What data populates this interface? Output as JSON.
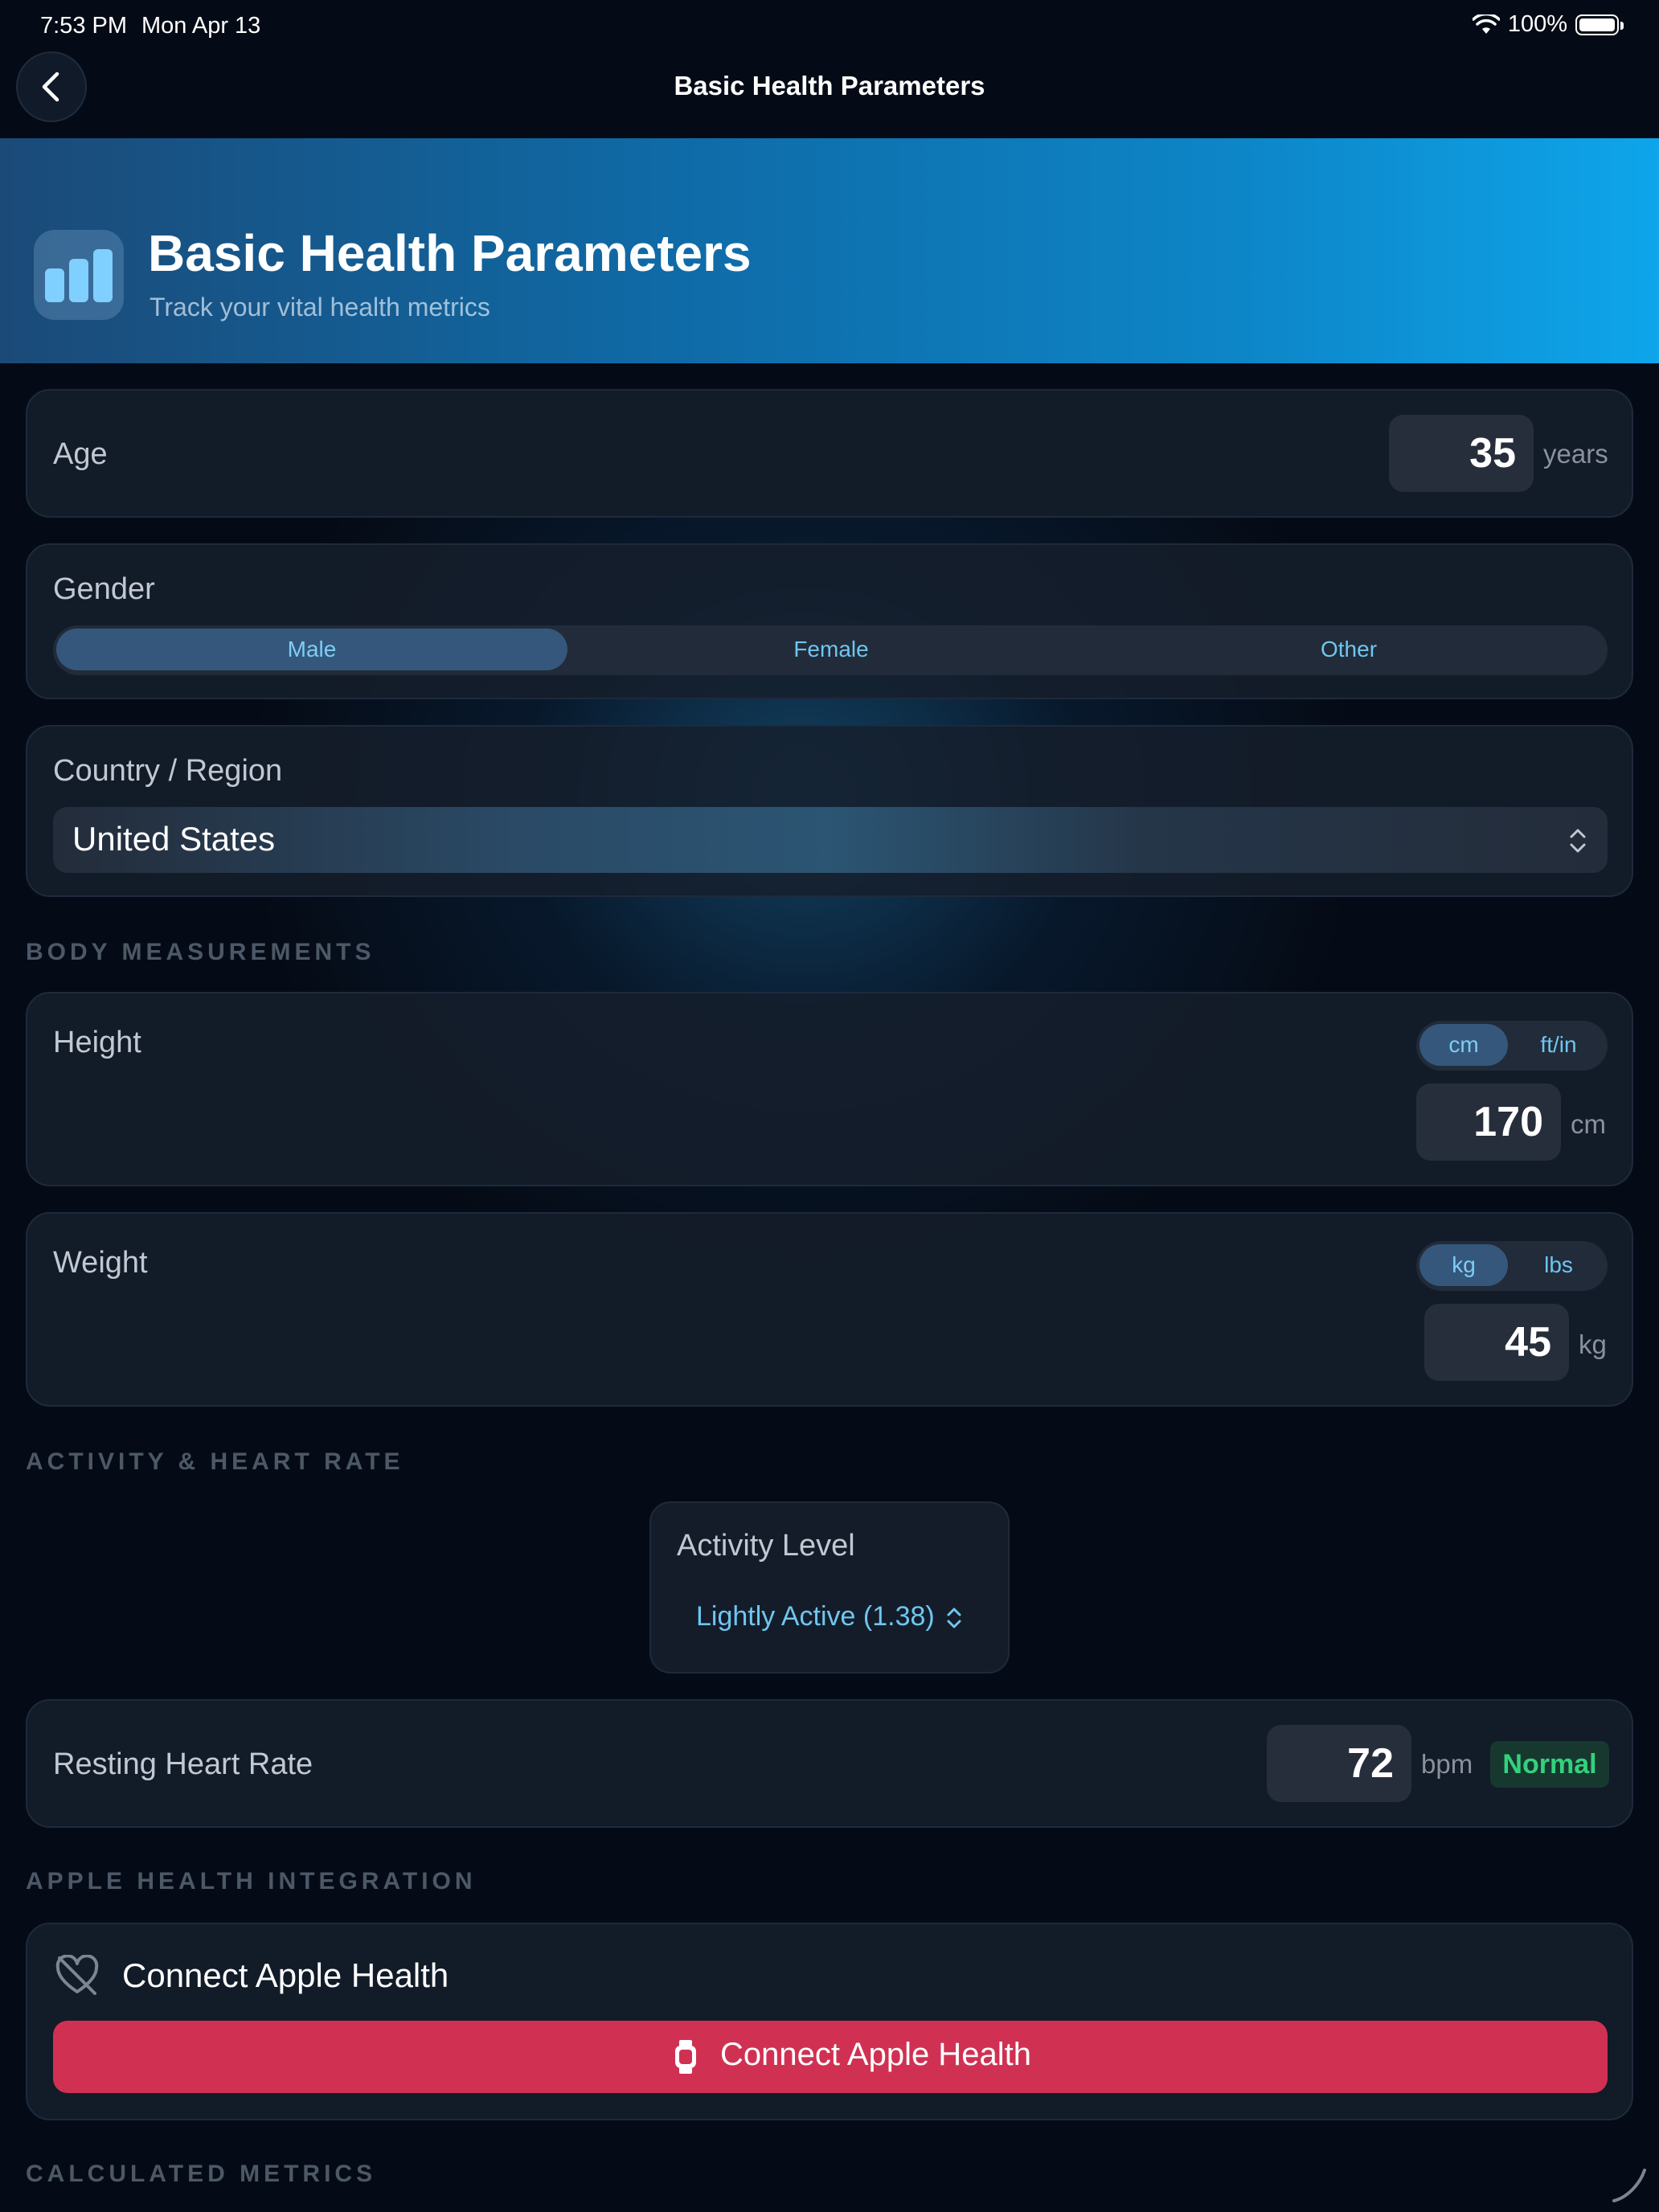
{
  "status_bar": {
    "time": "7:53 PM",
    "date": "Mon Apr 13",
    "battery": "100%"
  },
  "nav": {
    "title": "Basic Health Parameters"
  },
  "banner": {
    "title": "Basic Health Parameters",
    "subtitle": "Track your vital health metrics"
  },
  "age": {
    "label": "Age",
    "value": "35",
    "unit": "years"
  },
  "gender": {
    "label": "Gender",
    "options": [
      "Male",
      "Female",
      "Other"
    ],
    "selected": "Male"
  },
  "country": {
    "label": "Country / Region",
    "value": "United States"
  },
  "sections": {
    "body": "BODY MEASUREMENTS",
    "activity": "ACTIVITY & HEART RATE",
    "apple": "APPLE HEALTH INTEGRATION",
    "calculated": "CALCULATED METRICS"
  },
  "height": {
    "label": "Height",
    "units": [
      "cm",
      "ft/in"
    ],
    "selected_unit": "cm",
    "value": "170",
    "unit": "cm"
  },
  "weight": {
    "label": "Weight",
    "units": [
      "kg",
      "lbs"
    ],
    "selected_unit": "kg",
    "value": "45",
    "unit": "kg"
  },
  "activity": {
    "label": "Activity Level",
    "value": "Lightly Active (1.38)"
  },
  "heart_rate": {
    "label": "Resting Heart Rate",
    "value": "72",
    "unit": "bpm",
    "status": "Normal"
  },
  "apple_health": {
    "title": "Connect Apple Health",
    "button": "Connect Apple Health"
  },
  "colors": {
    "accent": "#6fc6ef",
    "button": "#d03153",
    "normal": "#34d17d"
  }
}
